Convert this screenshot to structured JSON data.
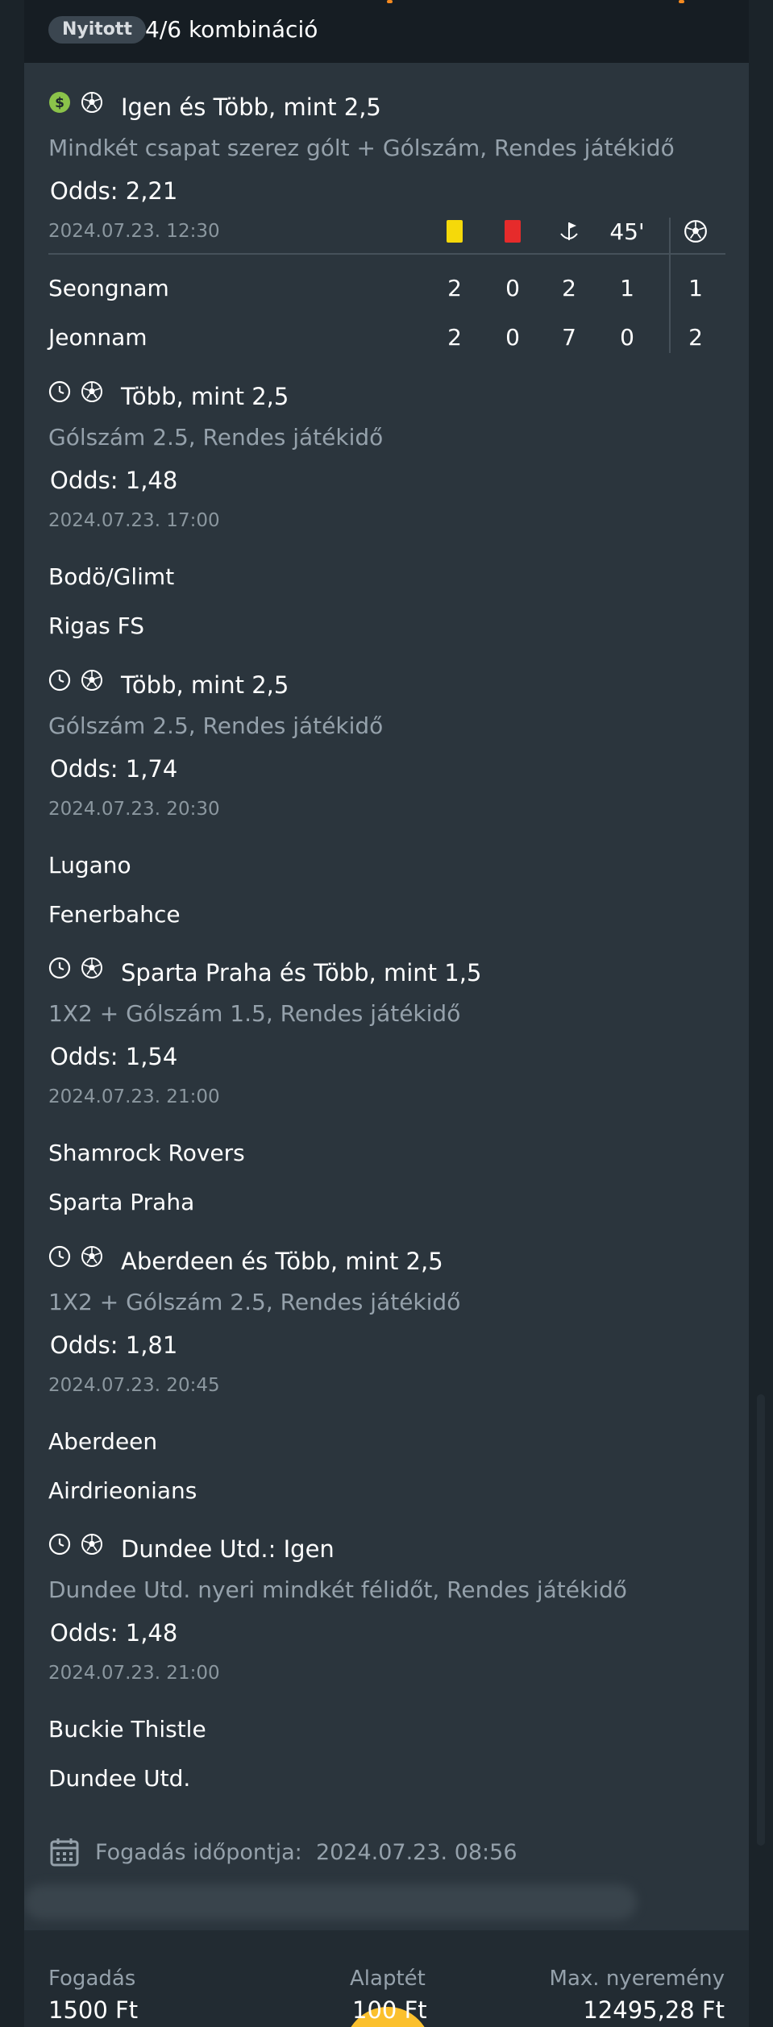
{
  "header": {
    "status_badge": "Nyitott",
    "combination": "4/6 kombináció"
  },
  "bets": [
    {
      "status_icon": "dollar-circle-icon",
      "sport_icon": "soccer-ball-icon",
      "title": "Igen és Több, mint 2,5",
      "market": "Mindkét csapat szerez gólt + Gólszám, Rendes játékidő",
      "odds_label": "Odds:",
      "odds_value": "2,21",
      "datetime": "2024.07.23.  12:30",
      "home": "Seongnam",
      "away": "Jeonnam"
    },
    {
      "status_icon": "clock-icon",
      "sport_icon": "soccer-ball-icon",
      "title": "Több, mint 2,5",
      "market": "Gólszám 2.5, Rendes játékidő",
      "odds_label": "Odds:",
      "odds_value": "1,48",
      "datetime": "2024.07.23.  17:00",
      "home": "Bodö/Glimt",
      "away": "Rigas FS"
    },
    {
      "status_icon": "clock-icon",
      "sport_icon": "soccer-ball-icon",
      "title": "Több, mint 2,5",
      "market": "Gólszám 2.5, Rendes játékidő",
      "odds_label": "Odds:",
      "odds_value": "1,74",
      "datetime": "2024.07.23.  20:30",
      "home": "Lugano",
      "away": "Fenerbahce"
    },
    {
      "status_icon": "clock-icon",
      "sport_icon": "soccer-ball-icon",
      "title": "Sparta Praha és Több, mint 1,5",
      "market": "1X2 + Gólszám 1.5, Rendes játékidő",
      "odds_label": "Odds:",
      "odds_value": "1,54",
      "datetime": "2024.07.23.  21:00",
      "home": "Shamrock Rovers",
      "away": "Sparta Praha"
    },
    {
      "status_icon": "clock-icon",
      "sport_icon": "soccer-ball-icon",
      "title": "Aberdeen és Több, mint 2,5",
      "market": "1X2 + Gólszám 2.5, Rendes játékidő",
      "odds_label": "Odds:",
      "odds_value": "1,81",
      "datetime": "2024.07.23.  20:45",
      "home": "Aberdeen",
      "away": "Airdrieonians"
    },
    {
      "status_icon": "clock-icon",
      "sport_icon": "soccer-ball-icon",
      "title": "Dundee Utd.: Igen",
      "market": "Dundee Utd. nyeri mindkét félidőt, Rendes játékidő",
      "odds_label": "Odds:",
      "odds_value": "1,48",
      "datetime": "2024.07.23.  21:00",
      "home": "Buckie Thistle",
      "away": "Dundee Utd."
    }
  ],
  "live_stats": {
    "columns": [
      "yellow-card-icon",
      "red-card-icon",
      "corner-flag-icon",
      "45'",
      "soccer-ball-icon"
    ],
    "home": [
      "2",
      "0",
      "2",
      "1",
      "1"
    ],
    "away": [
      "2",
      "0",
      "7",
      "0",
      "2"
    ],
    "colors": {
      "yellow": "#f5d90a",
      "red": "#e62b2b"
    }
  },
  "placed": {
    "icon": "calendar-icon",
    "label": "Fogadás időpontja:",
    "value": "2024.07.23.  08:56"
  },
  "footer": {
    "stake_label": "Fogadás",
    "stake_value": "1500 Ft",
    "base_label": "Alaptét",
    "base_value": "100 Ft",
    "max_label": "Max. nyeremény",
    "max_value": "12495,28 Ft"
  },
  "colors": {
    "accent_orange": "#f58a1f",
    "accent_yellow": "#fbc02d",
    "dollar_green": "#8bc34a"
  }
}
